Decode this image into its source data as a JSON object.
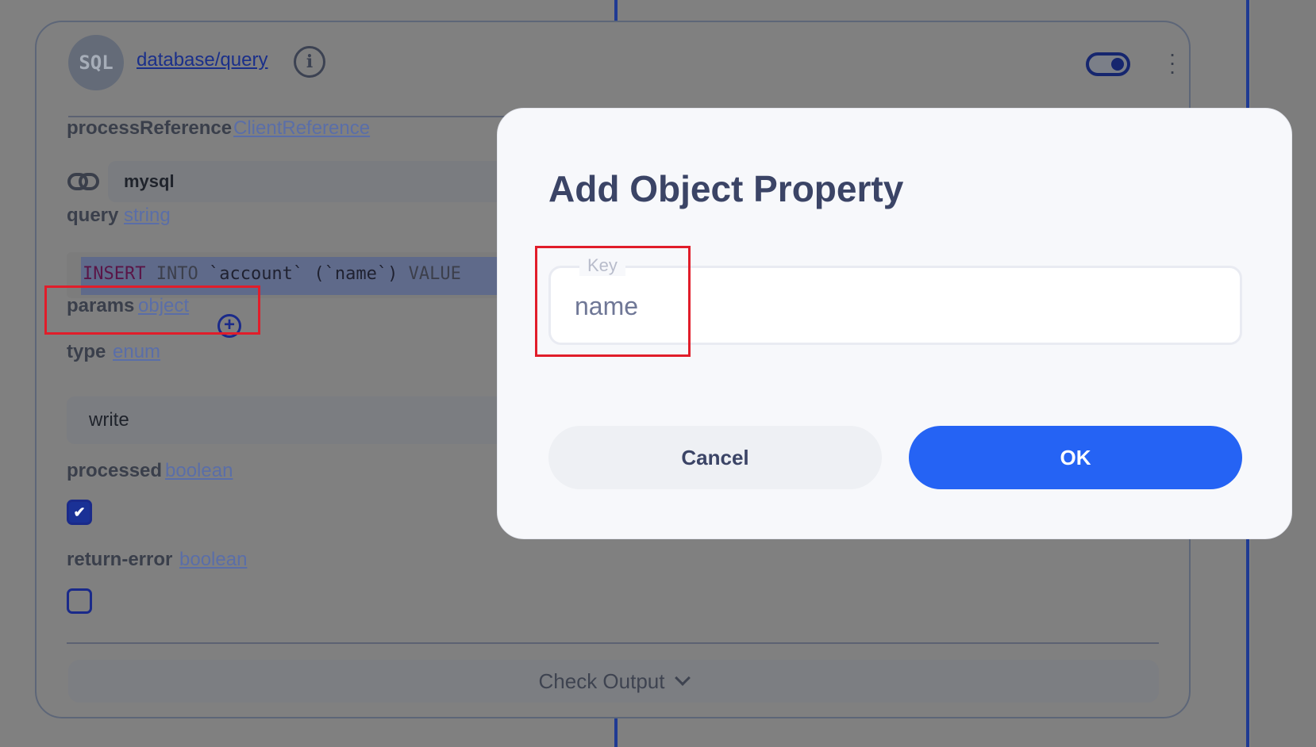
{
  "node": {
    "avatar_text": "SQL",
    "title": "database/query",
    "enabled": true
  },
  "fields": {
    "processReference": {
      "label": "processReference",
      "type": "ClientReference",
      "value": "mysql"
    },
    "query": {
      "label": "query",
      "type": "string",
      "code_kw1": "INSERT",
      "code_kw2": "INTO",
      "code_rest": " `account` (`name`) ",
      "code_tail": "VALUE"
    },
    "params": {
      "label": "params",
      "type": "object"
    },
    "type": {
      "label": "type",
      "type": "enum",
      "value": "write"
    },
    "processed": {
      "label": "processed",
      "type": "boolean",
      "checked": true
    },
    "return_error": {
      "label": "return-error",
      "type": "boolean",
      "checked": false
    }
  },
  "check_output_label": "Check Output",
  "modal": {
    "title": "Add Object Property",
    "key_label": "Key",
    "key_value": "name",
    "cancel_label": "Cancel",
    "ok_label": "OK"
  },
  "colors": {
    "accent": "#2563f4",
    "highlight": "#e11d2a",
    "title": "#3b4466"
  }
}
